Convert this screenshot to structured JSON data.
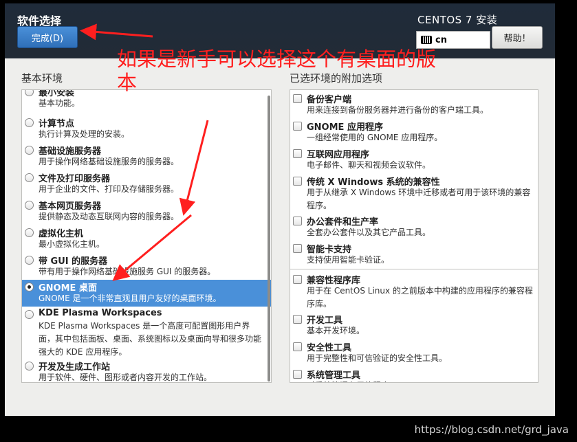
{
  "header": {
    "title": "软件选择",
    "done_label": "完成(D)",
    "product": "CENTOS 7 安装",
    "keyboard_layout": "cn",
    "help_label": "帮助！"
  },
  "left": {
    "label": "基本环境",
    "items": [
      {
        "name": "最小安装",
        "desc": "基本功能。",
        "selected": false
      },
      {
        "name": "计算节点",
        "desc": "执行计算及处理的安装。",
        "selected": false
      },
      {
        "name": "基础设施服务器",
        "desc": "用于操作网络基础设施服务的服务器。",
        "selected": false
      },
      {
        "name": "文件及打印服务器",
        "desc": "用于企业的文件、打印及存储服务器。",
        "selected": false
      },
      {
        "name": "基本网页服务器",
        "desc": "提供静态及动态互联网内容的服务器。",
        "selected": false
      },
      {
        "name": "虚拟化主机",
        "desc": "最小虚拟化主机。",
        "selected": false
      },
      {
        "name": "带 GUI 的服务器",
        "desc": "带有用于操作网络基础设施服务 GUI 的服务器。",
        "selected": false
      },
      {
        "name": "GNOME 桌面",
        "desc": "GNOME 是一个非常直观且用户友好的桌面环境。",
        "selected": true
      },
      {
        "name": "KDE Plasma Workspaces",
        "desc": "KDE Plasma Workspaces 是一个高度可配置图形用户界面，其中包括面板、桌面、系统图标以及桌面向导和很多功能强大的 KDE 应用程序。",
        "selected": false
      },
      {
        "name": "开发及生成工作站",
        "desc": "用于软件、硬件、图形或者内容开发的工作站。",
        "selected": false
      }
    ]
  },
  "right": {
    "label": "已选环境的附加选项",
    "items": [
      {
        "name": "备份客户端",
        "desc": "用来连接到备份服务器并进行备份的客户端工具。"
      },
      {
        "name": "GNOME 应用程序",
        "desc": "一组经常使用的 GNOME 应用程序。"
      },
      {
        "name": "互联网应用程序",
        "desc": "电子邮件、聊天和视频会议软件。"
      },
      {
        "name": "传统 X Windows 系统的兼容性",
        "desc": "用于从继承 X Windows 环境中迁移或者可用于该环境的兼容程序。"
      },
      {
        "name": "办公套件和生产率",
        "desc": "全套办公套件以及其它产品工具。"
      },
      {
        "name": "智能卡支持",
        "desc": "支持使用智能卡验证。"
      },
      {
        "name": "兼容性程序库",
        "desc": "用于在 CentOS Linux 的之前版本中构建的应用程序的兼容程序库。"
      },
      {
        "name": "开发工具",
        "desc": "基本开发环境。"
      },
      {
        "name": "安全性工具",
        "desc": "用于完整性和可信验证的安全性工具。"
      },
      {
        "name": "系统管理工具",
        "desc": "对系统管理有用的程序。"
      }
    ]
  },
  "annotation": {
    "text_line1": "如果是新手可以选择这个有桌面的版",
    "text_line2": "本",
    "color": "#ff1f1f"
  },
  "watermark": "https://blog.csdn.net/grd_java"
}
